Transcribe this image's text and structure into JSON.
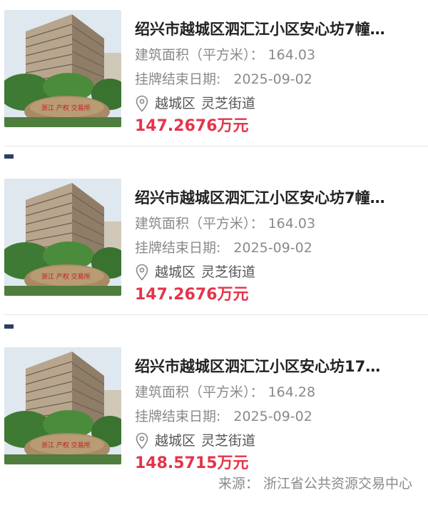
{
  "listings": [
    {
      "title": "绍兴市越城区泗汇江小区安心坊7幢…",
      "area_label": "建筑面积（平方米）：",
      "area_value": "164.03",
      "end_date_label": "挂牌结束日期:",
      "end_date_value": "2025-09-02",
      "icon": "location-pin-icon",
      "district": "越城区",
      "street": "灵芝街道",
      "price": "147.2676万元"
    },
    {
      "title": "绍兴市越城区泗汇江小区安心坊7幢…",
      "area_label": "建筑面积（平方米）：",
      "area_value": "164.03",
      "end_date_label": "挂牌结束日期:",
      "end_date_value": "2025-09-02",
      "icon": "location-pin-icon",
      "district": "越城区",
      "street": "灵芝街道",
      "price": "147.2676万元"
    },
    {
      "title": "绍兴市越城区泗汇江小区安心坊17…",
      "area_label": "建筑面积（平方米）：",
      "area_value": "164.28",
      "end_date_label": "挂牌结束日期:",
      "end_date_value": "2025-09-02",
      "icon": "location-pin-icon",
      "district": "越城区",
      "street": "灵芝街道",
      "price": "148.5715万元"
    }
  ],
  "footer": {
    "source": "来源：  浙江省公共资源交易中心"
  },
  "colors": {
    "price": "#e5344a",
    "title": "#222222",
    "meta": "#8a8a8a",
    "bullet": "#2f3f63"
  }
}
